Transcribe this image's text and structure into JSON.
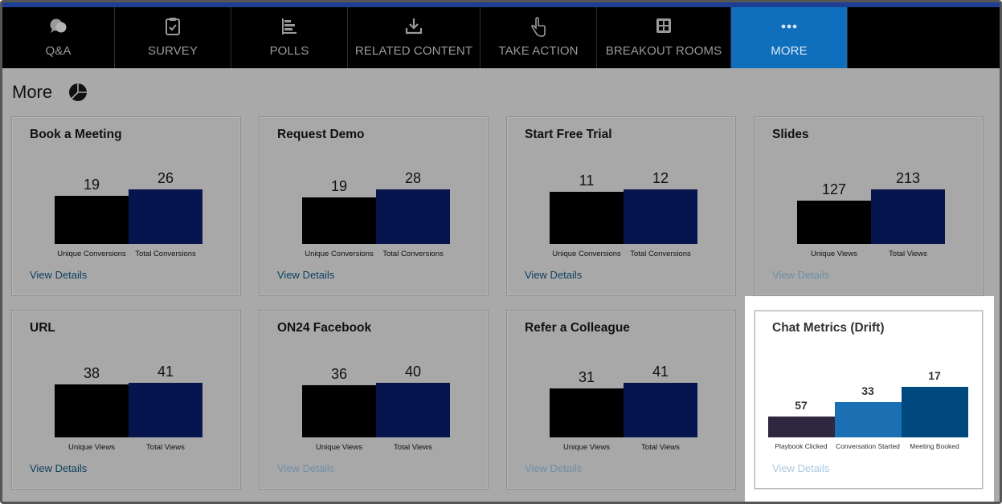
{
  "nav": {
    "tabs": [
      {
        "label": "Q&A",
        "icon": "chat-bubbles-icon",
        "active": false
      },
      {
        "label": "SURVEY",
        "icon": "clipboard-check-icon",
        "active": false
      },
      {
        "label": "POLLS",
        "icon": "bar-list-icon",
        "active": false
      },
      {
        "label": "RELATED CONTENT",
        "icon": "download-icon",
        "active": false
      },
      {
        "label": "TAKE ACTION",
        "icon": "pointer-hand-icon",
        "active": false
      },
      {
        "label": "BREAKOUT ROOMS",
        "icon": "grid-rooms-icon",
        "active": false
      },
      {
        "label": "MORE",
        "icon": "more-dots-icon",
        "active": true
      }
    ]
  },
  "page": {
    "title": "More",
    "title_icon": "pie-chart-icon"
  },
  "cards": [
    {
      "title": "Book a Meeting",
      "link": "View Details",
      "bars": [
        {
          "label": "Unique Conversions",
          "value": 19
        },
        {
          "label": "Total Conversions",
          "value": 26
        }
      ]
    },
    {
      "title": "Request Demo",
      "link": "View Details",
      "bars": [
        {
          "label": "Unique Conversions",
          "value": 19
        },
        {
          "label": "Total Conversions",
          "value": 28
        }
      ]
    },
    {
      "title": "Start Free Trial",
      "link": "View Details",
      "bars": [
        {
          "label": "Unique Conversions",
          "value": 11
        },
        {
          "label": "Total Conversions",
          "value": 12
        }
      ]
    },
    {
      "title": "Slides",
      "link": "View Details",
      "bars": [
        {
          "label": "Unique Views",
          "value": 127
        },
        {
          "label": "Total Views",
          "value": 213
        }
      ]
    },
    {
      "title": "URL",
      "link": "View Details",
      "bars": [
        {
          "label": "Unique Views",
          "value": 38
        },
        {
          "label": "Total Views",
          "value": 41
        }
      ]
    },
    {
      "title": "ON24 Facebook",
      "link": "View Details",
      "bars": [
        {
          "label": "Unique Views",
          "value": 36
        },
        {
          "label": "Total Views",
          "value": 40
        }
      ]
    },
    {
      "title": "Refer a Colleague",
      "link": "View Details",
      "bars": [
        {
          "label": "Unique Views",
          "value": 31
        },
        {
          "label": "Total Views",
          "value": 41
        }
      ]
    },
    {
      "title": "Chat Metrics (Drift)",
      "link": "View Details",
      "highlighted": true,
      "bars": [
        {
          "label": "Playbook Clicked",
          "value": 57
        },
        {
          "label": "Conversation Started",
          "value": 33
        },
        {
          "label": "Meeting Booked",
          "value": 17
        }
      ]
    }
  ],
  "colors": {
    "bar_unique": "#000000",
    "bar_total": "#07154f",
    "drift_bar_1": "#2f2740",
    "drift_bar_2": "#1b6fb3",
    "drift_bar_3": "#00497e",
    "nav_active": "#0f6fbd",
    "link": "#0b3e5f"
  }
}
